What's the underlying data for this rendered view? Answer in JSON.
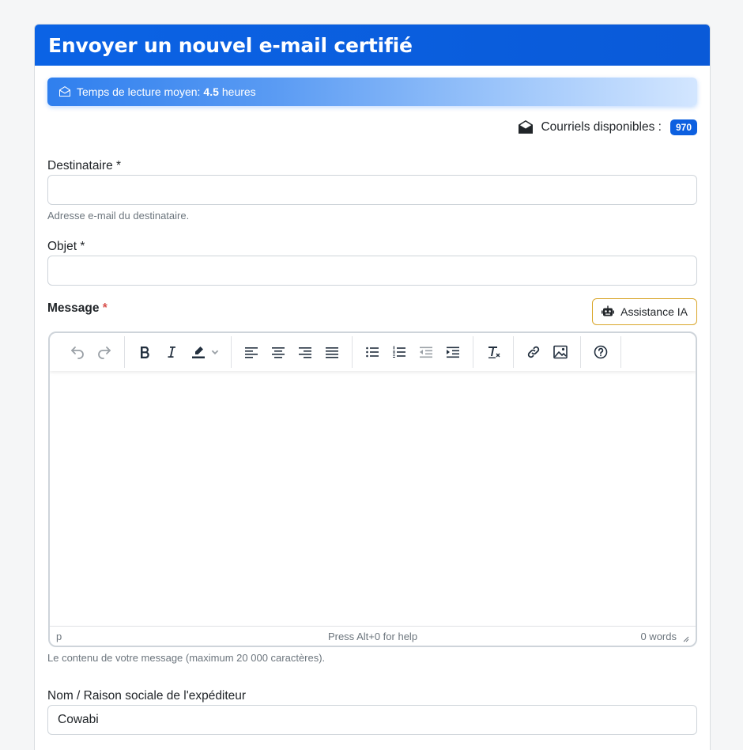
{
  "header": {
    "title": "Envoyer un nouvel e-mail certifié"
  },
  "info": {
    "prefix": "Temps de lecture moyen:",
    "value": "4.5",
    "unit": "heures"
  },
  "availability": {
    "label": "Courriels disponibles :",
    "count": "970"
  },
  "recipient": {
    "label": "Destinataire *",
    "value": "",
    "help": "Adresse e-mail du destinataire."
  },
  "subject": {
    "label": "Objet *",
    "value": ""
  },
  "message": {
    "label": "Message",
    "required_mark": "*",
    "ai_button": "Assistance IA",
    "help": "Le contenu de votre message (maximum 20 000 caractères).",
    "status_path": "p",
    "status_help": "Press Alt+0 for help",
    "word_count": "0 words"
  },
  "sender": {
    "label": "Nom / Raison sociale de l'expéditeur",
    "value": "Cowabi"
  }
}
